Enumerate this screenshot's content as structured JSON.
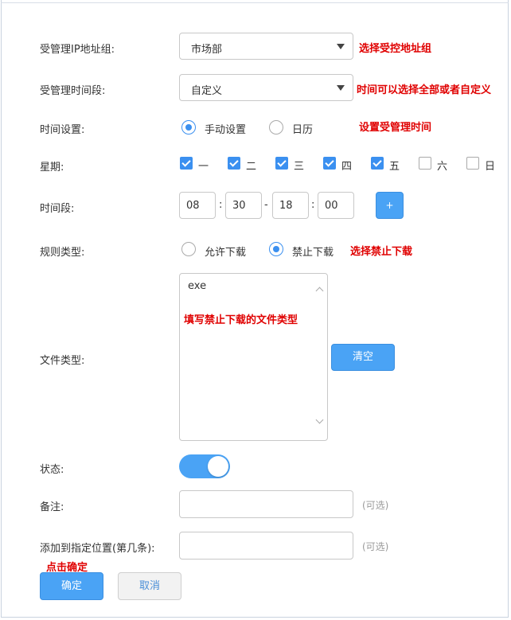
{
  "labels": {
    "ip_group": "受管理IP地址组:",
    "time_range": "受管理时间段:",
    "time_setting": "时间设置:",
    "weekday": "星期:",
    "time_period": "时间段:",
    "rule_type": "规则类型:",
    "file_type": "文件类型:",
    "status": "状态:",
    "remark": "备注:",
    "position": "添加到指定位置(第几条):"
  },
  "fields": {
    "ip_group_value": "市场部",
    "time_range_value": "自定义",
    "time_mode_options": [
      "手动设置",
      "日历"
    ],
    "time_mode_selected": "手动设置",
    "weekdays": [
      {
        "label": "一",
        "checked": true
      },
      {
        "label": "二",
        "checked": true
      },
      {
        "label": "三",
        "checked": true
      },
      {
        "label": "四",
        "checked": true
      },
      {
        "label": "五",
        "checked": true
      },
      {
        "label": "六",
        "checked": false
      },
      {
        "label": "日",
        "checked": false
      }
    ],
    "start_hour": "08",
    "start_minute": "30",
    "end_hour": "18",
    "end_minute": "00",
    "time_sep": ":",
    "range_sep": "-",
    "add_time_label": "+",
    "rule_options": [
      "允许下载",
      "禁止下载"
    ],
    "rule_selected": "禁止下载",
    "file_types_value": "exe",
    "clear_label": "清空",
    "status_on": true,
    "remark_value": "",
    "position_value": "",
    "optional_hint": "(可选)"
  },
  "annotations": {
    "ip_group_note": "选择受控地址组",
    "time_range_note": "时间可以选择全部或者自定义",
    "time_setting_note": "设置受管理时间",
    "rule_note": "选择禁止下载",
    "file_type_note": "填写禁止下载的文件类型",
    "confirm_note": "点击确定"
  },
  "buttons": {
    "confirm": "确定",
    "cancel": "取消"
  },
  "colors": {
    "accent": "#4aa3f5",
    "annotation": "#e00000"
  }
}
